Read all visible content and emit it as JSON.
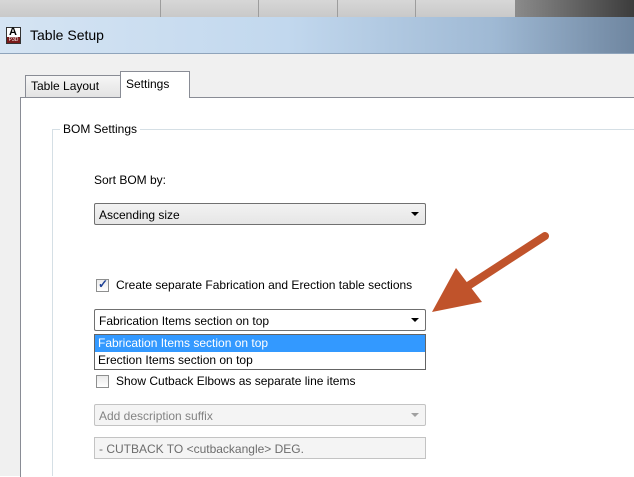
{
  "window": {
    "title": "Table Setup"
  },
  "tabs": [
    {
      "label": "Table Layout",
      "active": false
    },
    {
      "label": "Settings",
      "active": true
    }
  ],
  "bom_settings": {
    "group_label": "BOM Settings",
    "sort_label": "Sort BOM by:",
    "sort_value": "Ascending size",
    "separate_tables": {
      "label": "Create separate Fabrication and Erection table sections",
      "checked": true
    },
    "section_order_value": "Fabrication Items section on top",
    "section_order_options": [
      "Fabrication Items section on top",
      "Erection Items section on top"
    ],
    "show_cutback": {
      "label": "Show Cutback Elbows as separate line items",
      "checked": false
    },
    "description_suffix_value": "Add description suffix",
    "cutback_text": "- CUTBACK TO <cutbackangle> DEG."
  },
  "colors": {
    "selection_highlight": "#3399ff",
    "annotation_arrow": "#c0532b"
  }
}
